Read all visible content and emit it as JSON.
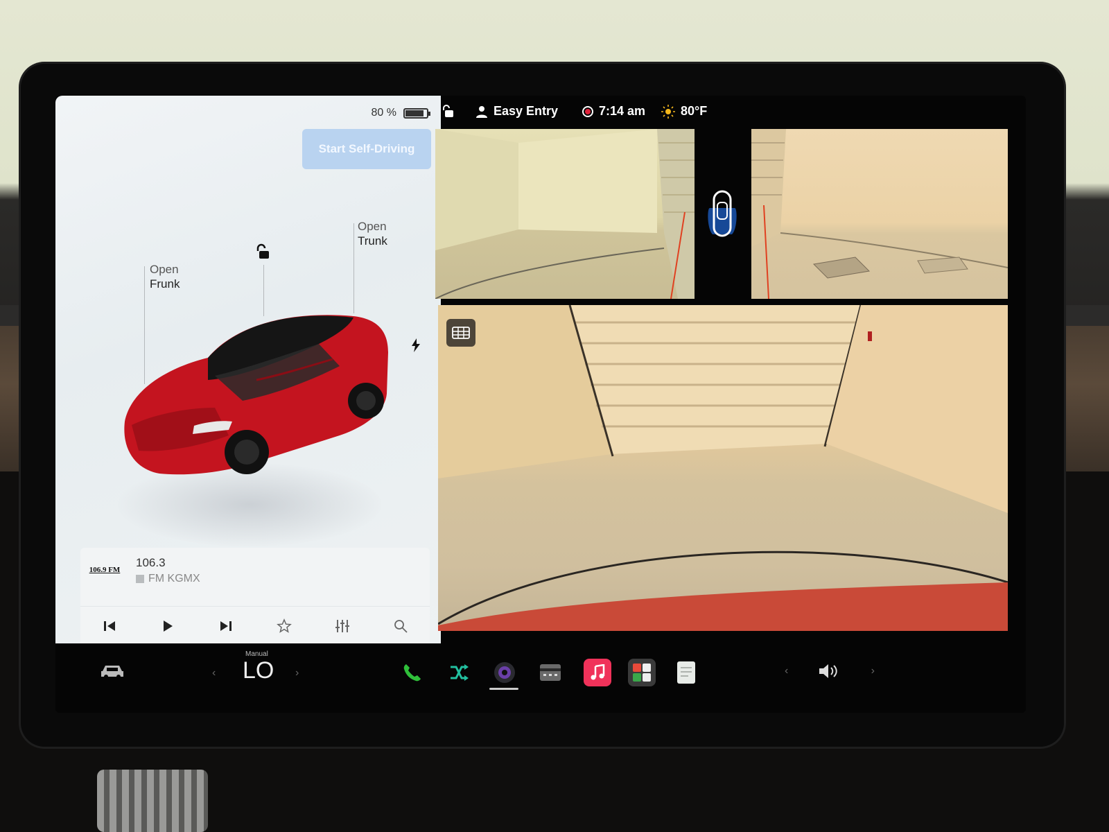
{
  "car_panel": {
    "battery_percent": "80 %",
    "battery_level": 0.8,
    "self_driving_button": "Start Self-Driving",
    "frunk": {
      "line1": "Open",
      "line2": "Frunk"
    },
    "trunk": {
      "line1": "Open",
      "line2": "Trunk"
    }
  },
  "media": {
    "station_logo": "106.9 FM",
    "frequency": "106.3",
    "station_name": "FM KGMX"
  },
  "status_bar": {
    "profile": "Easy Entry",
    "time": "7:14 am",
    "temperature": "80°F"
  },
  "climate": {
    "mode": "Manual",
    "temperature": "LO"
  },
  "colors": {
    "accent_blue": "#b9d3f0",
    "record_red": "#e0223a",
    "car_red": "#c4141f",
    "phone_green": "#2fbf3a",
    "music_pink": "#f0325a"
  },
  "icons": [
    "lock-icon",
    "bolt-icon",
    "user-icon",
    "record-icon",
    "sun-icon",
    "car-top-view-icon",
    "grid-icon",
    "car-icon",
    "phone-icon",
    "shuffle-icon",
    "camera-icon",
    "dashcam-icon",
    "music-icon",
    "toybox-icon",
    "notes-icon",
    "volume-icon",
    "previous-icon",
    "play-icon",
    "next-icon",
    "star-icon",
    "equalizer-icon",
    "search-icon"
  ]
}
